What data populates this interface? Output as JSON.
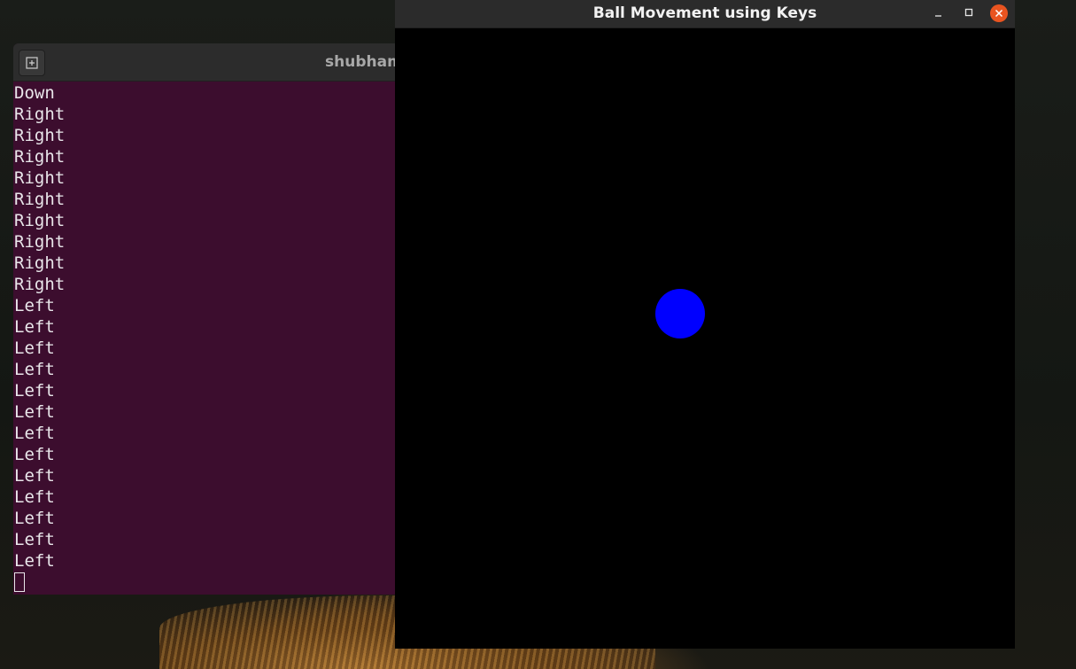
{
  "terminal": {
    "title": "shubham",
    "new_tab_icon": "new-tab-icon",
    "lines": [
      "Down",
      "Right",
      "Right",
      "Right",
      "Right",
      "Right",
      "Right",
      "Right",
      "Right",
      "Right",
      "Left",
      "Left",
      "Left",
      "Left",
      "Left",
      "Left",
      "Left",
      "Left",
      "Left",
      "Left",
      "Left",
      "Left",
      "Left"
    ]
  },
  "game_window": {
    "title": "Ball Movement using Keys",
    "buttons": [
      "minimize-icon",
      "maximize-icon",
      "close-icon"
    ],
    "ball_color": "#0000ff",
    "background_color": "#000000"
  },
  "colors": {
    "terminal_bg": "#3c0d2e",
    "close_button": "#e95420"
  }
}
